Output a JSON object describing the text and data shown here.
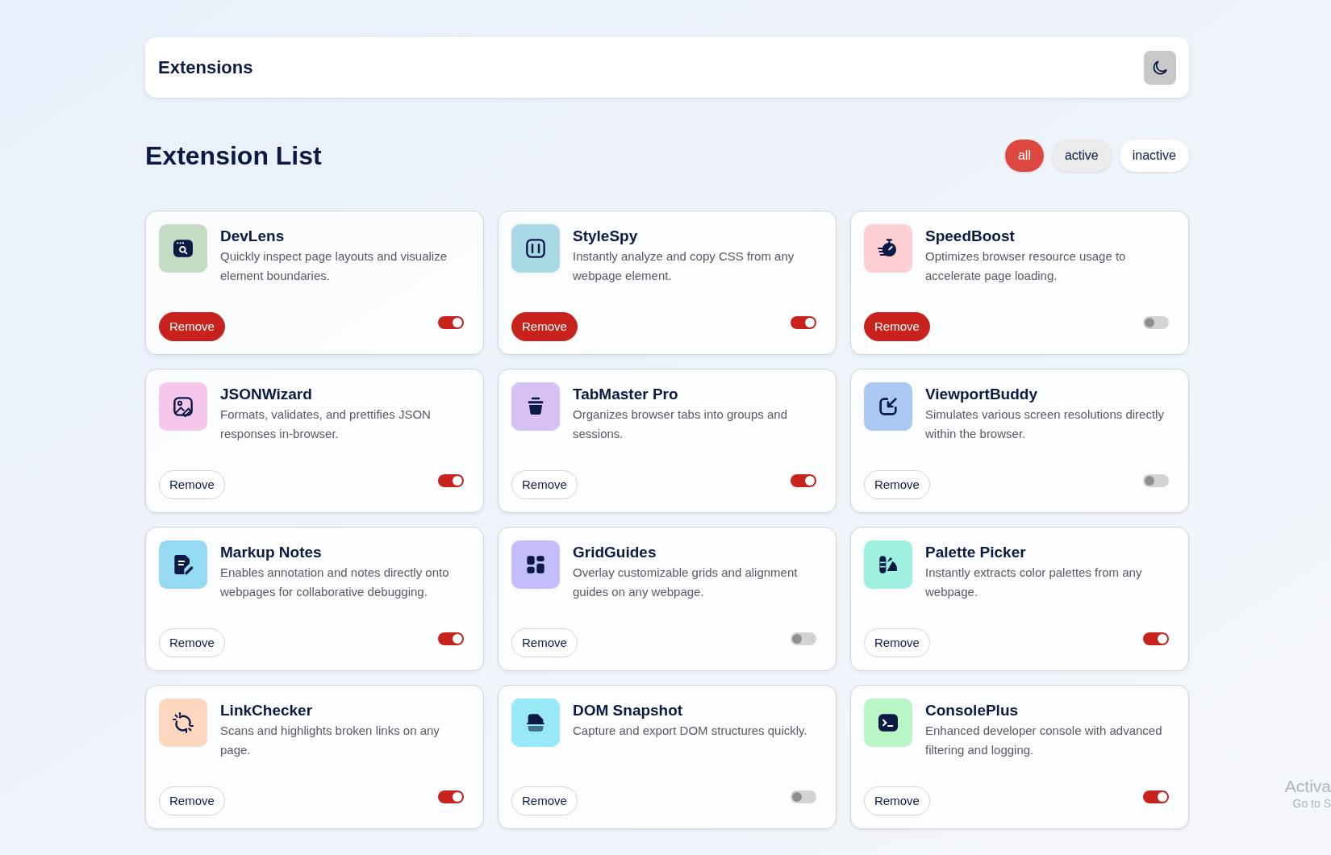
{
  "header": {
    "title": "Extensions"
  },
  "list_title": "Extension List",
  "filters": [
    {
      "label": "all",
      "selected": true,
      "highlighted": false
    },
    {
      "label": "active",
      "selected": false,
      "highlighted": true
    },
    {
      "label": "inactive",
      "selected": false,
      "highlighted": false
    }
  ],
  "extensions": [
    {
      "name": "DevLens",
      "description": "Quickly inspect page layouts and visualize element boundaries.",
      "color": "#c5dcc4",
      "button": "Remove",
      "highlighted": true,
      "on": true
    },
    {
      "name": "StyleSpy",
      "description": "Instantly analyze and copy CSS from any webpage element.",
      "color": "#a9d8e5",
      "button": "Remove",
      "highlighted": true,
      "on": true
    },
    {
      "name": "SpeedBoost",
      "description": "Optimizes browser resource usage to accelerate page loading.",
      "color": "#fdcfd3",
      "button": "Remove",
      "highlighted": true,
      "on": false
    },
    {
      "name": "JSONWizard",
      "description": "Formats, validates, and prettifies JSON responses in-browser.",
      "color": "#f5c6ea",
      "button": "Remove",
      "highlighted": false,
      "on": true
    },
    {
      "name": "TabMaster Pro",
      "description": "Organizes browser tabs into groups and sessions.",
      "color": "#d7c1f2",
      "button": "Remove",
      "highlighted": false,
      "on": true
    },
    {
      "name": "ViewportBuddy",
      "description": "Simulates various screen resolutions directly within the browser.",
      "color": "#a9c9f3",
      "button": "Remove",
      "highlighted": false,
      "on": false
    },
    {
      "name": "Markup Notes",
      "description": "Enables annotation and notes directly onto webpages for collaborative debugging.",
      "color": "#95d9f2",
      "button": "Remove",
      "highlighted": false,
      "on": true
    },
    {
      "name": "GridGuides",
      "description": "Overlay customizable grids and alignment guides on any webpage.",
      "color": "#c3bdfb",
      "button": "Remove",
      "highlighted": false,
      "on": false
    },
    {
      "name": "Palette Picker",
      "description": "Instantly extracts color palettes from any webpage.",
      "color": "#9ef0e0",
      "button": "Remove",
      "highlighted": false,
      "on": true
    },
    {
      "name": "LinkChecker",
      "description": "Scans and highlights broken links on any page.",
      "color": "#fed7bf",
      "button": "Remove",
      "highlighted": false,
      "on": true
    },
    {
      "name": "DOM Snapshot",
      "description": "Capture and export DOM structures quickly.",
      "color": "#98e9f5",
      "button": "Remove",
      "highlighted": false,
      "on": false
    },
    {
      "name": "ConsolePlus",
      "description": "Enhanced developer console with advanced filtering and logging.",
      "color": "#b8f6c6",
      "button": "Remove",
      "highlighted": false,
      "on": true
    }
  ],
  "os_overlay": {
    "line_1": "Activa",
    "line_2": "Go to S"
  }
}
